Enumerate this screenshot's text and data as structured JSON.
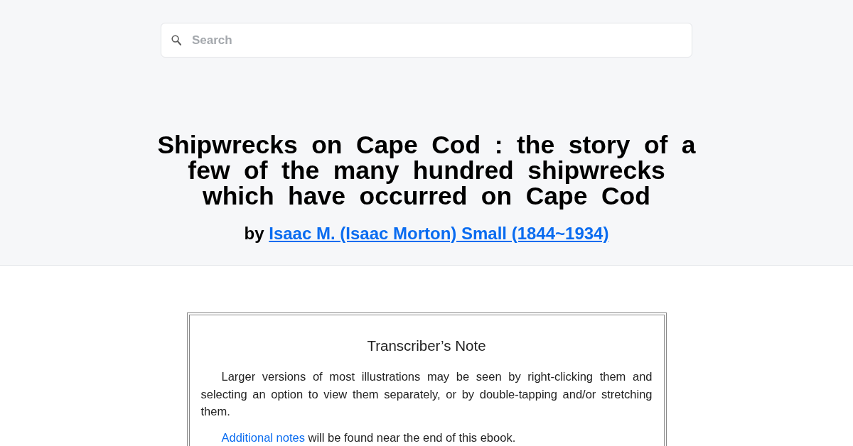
{
  "search": {
    "placeholder": "Search"
  },
  "book": {
    "title": "Shipwrecks on Cape Cod : the story of a few of the many hundred shipwrecks which have occurred on Cape Cod",
    "byline": {
      "prefix": "by",
      "author": "Isaac M. (Isaac Morton) Small (1844~1934)"
    }
  },
  "note": {
    "heading": "Transcriber’s Note",
    "paragraphs": [
      {
        "text": "Larger versions of most illustrations may be seen by right-clicking them and selecting an option to view them separately, or by double-tapping and/or stretching them."
      },
      {
        "link": "Additional notes",
        "text": "will be found near the end of this ebook."
      }
    ]
  }
}
